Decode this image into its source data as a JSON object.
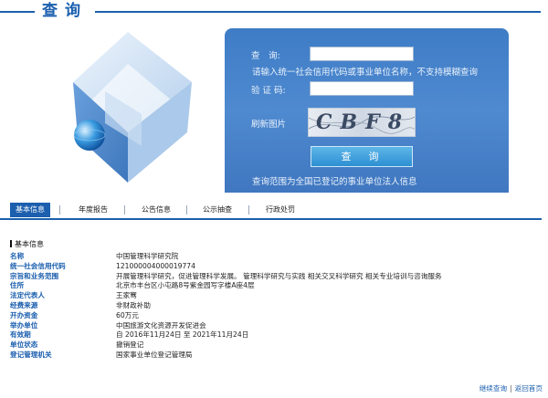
{
  "header": {
    "title": "查询"
  },
  "form": {
    "query_label": "查　询:",
    "hint": "请输入统一社会信用代码或事业单位名称，不支持模糊查询",
    "captcha_label": "验 证 码:",
    "refresh_label": "刷新图片",
    "captcha_text": "CBF8",
    "submit_label": "查　询",
    "scope_note": "查询范围为全国已登记的事业单位法人信息"
  },
  "tabs": [
    {
      "label": "基本信息",
      "active": true
    },
    {
      "label": "年度报告"
    },
    {
      "label": "公告信息"
    },
    {
      "label": "公示抽查"
    },
    {
      "label": "行政处罚"
    }
  ],
  "section_title": "基本信息",
  "info": [
    {
      "key": "名称",
      "value": "中国管理科学研究院"
    },
    {
      "key": "统一社会信用代码",
      "value": "121000004000019774"
    },
    {
      "key": "宗旨和业务范围",
      "value": "开展管理科学研究，促进管理科学发展。 管理科学研究与实践 相关交叉科学研究 相关专业培训与咨询服务"
    },
    {
      "key": "住所",
      "value": "北京市丰台区小屯路8号紫金园写字楼A座4层"
    },
    {
      "key": "法定代表人",
      "value": "王家骞"
    },
    {
      "key": "经费来源",
      "value": "非财政补助"
    },
    {
      "key": "开办资金",
      "value": "60万元"
    },
    {
      "key": "举办单位",
      "value": "中国旅游文化资源开发促进会"
    },
    {
      "key": "有效期",
      "value": "自 2016年11月24日 至 2021年11月24日"
    },
    {
      "key": "单位状态",
      "value": "撤销登记"
    },
    {
      "key": "登记管理机关",
      "value": "国家事业单位登记管理局"
    }
  ],
  "footer": {
    "continue_label": "继续查询",
    "back_label": "返回首页"
  },
  "colors": {
    "brand": "#1b5fae",
    "panel": "#4a85cc"
  }
}
